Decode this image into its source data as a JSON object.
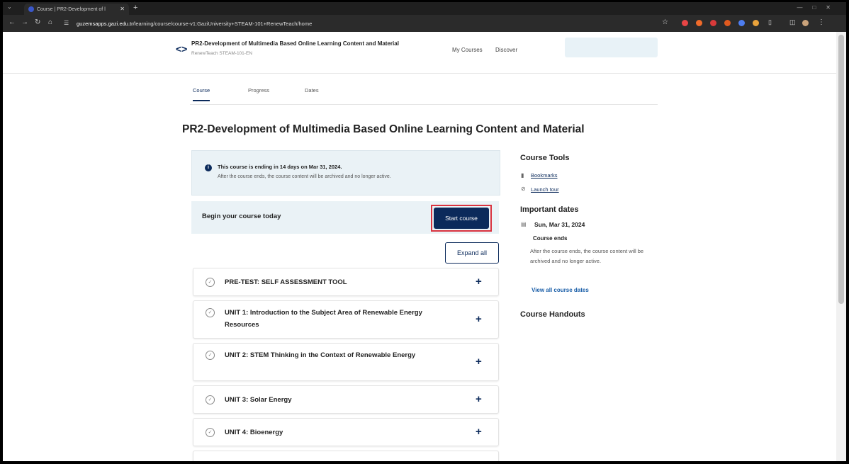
{
  "browser": {
    "tab_title": "Course | PR2-Development of l",
    "url_host": "guzemsapps.gazi.edu.tr",
    "url_path": "/learning/course/course-v1:GaziUniversity+STEAM-101+RenewTeach/home",
    "extension_colors": [
      "#e84545",
      "#f06b2a",
      "#d93a3a",
      "#e05a1f",
      "#4d7df0",
      "#e9a23b"
    ]
  },
  "header": {
    "course_title": "PR2-Development of Multimedia Based Online Learning Content and Material",
    "course_org": "RenewTeach STEAM-101-EN",
    "nav": [
      "My Courses",
      "Discover"
    ]
  },
  "tabs": [
    "Course",
    "Progress",
    "Dates"
  ],
  "main": {
    "title": "PR2-Development of Multimedia Based Online Learning Content and Material",
    "alert": {
      "line1": "This course is ending in 14 days on Mar 31, 2024.",
      "line2": "After the course ends, the course content will be archived and no longer active."
    },
    "begin_label": "Begin your course today",
    "start_button": "Start course",
    "expand_button": "Expand all",
    "units": [
      {
        "title": "PRE-TEST: SELF ASSESSMENT TOOL"
      },
      {
        "title": "UNIT 1: Introduction to the Subject Area of Renewable Energy Resources"
      },
      {
        "title": "UNIT 2: STEM Thinking in the Context of Renewable Energy"
      },
      {
        "title": "UNIT 3: Solar Energy"
      },
      {
        "title": "UNIT 4: Bioenergy"
      }
    ]
  },
  "sidebar": {
    "tools_heading": "Course Tools",
    "bookmarks": "Bookmarks",
    "launch_tour": "Launch tour",
    "dates_heading": "Important dates",
    "date": "Sun, Mar 31, 2024",
    "course_ends": "Course ends",
    "course_ends_desc": "After the course ends, the course content will be archived and no longer active.",
    "view_all": "View all course dates",
    "handouts_heading": "Course Handouts"
  }
}
